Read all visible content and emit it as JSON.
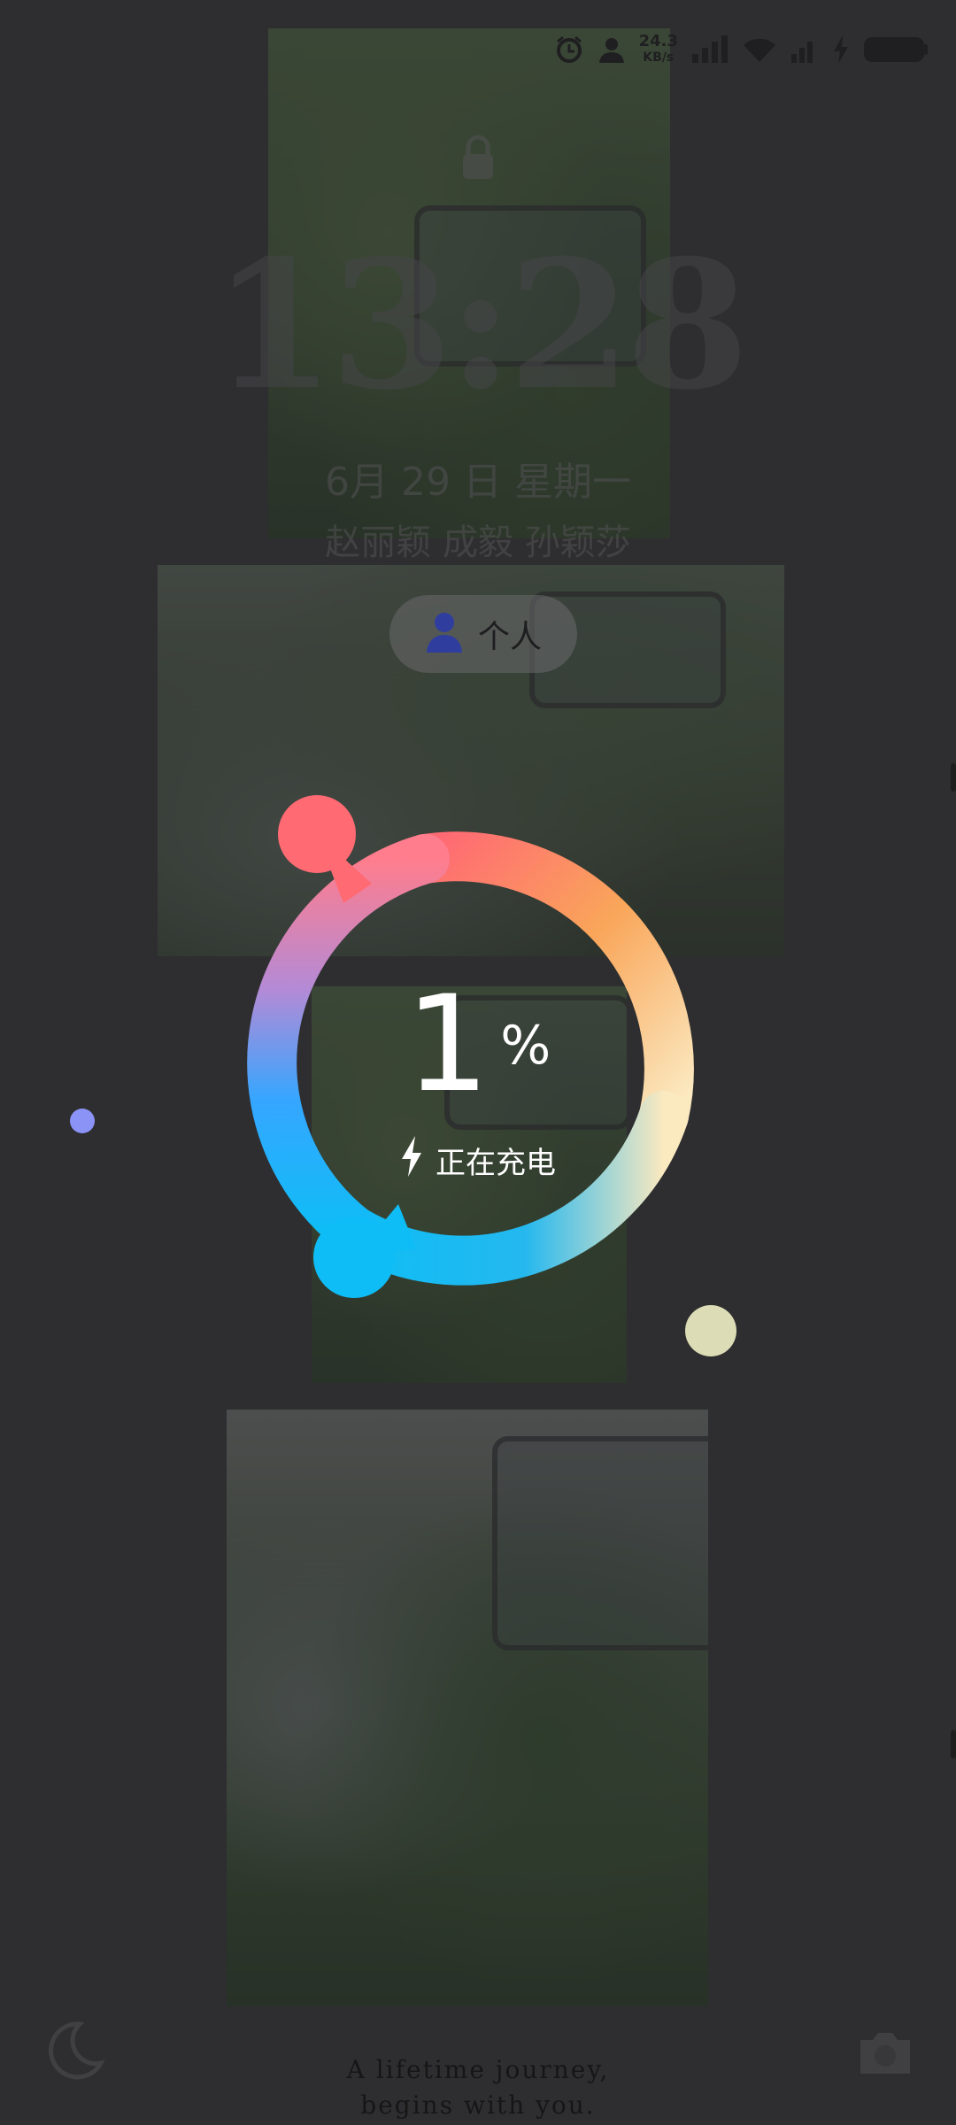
{
  "status_bar": {
    "net_speed_value": "24.3",
    "net_speed_unit": "KB/s",
    "icons": [
      "alarm-icon",
      "user-icon",
      "signal-icon",
      "wifi-icon",
      "battery-charging-icon"
    ]
  },
  "lockscreen": {
    "time": "13:28",
    "date": "6月 29 日 星期一",
    "names": "赵丽颖 成毅 孙颖莎",
    "profile_label": "个人"
  },
  "charging": {
    "percent_value": "1",
    "percent_sign": "%",
    "status_text": "正在充电",
    "level": 0.01
  },
  "footer": {
    "tagline_line1": "A lifetime journey,",
    "tagline_line2": "begins with you."
  },
  "colors": {
    "ring_red": "#ff6a73",
    "ring_orange": "#f9a65a",
    "ring_cream": "#fbe9c0",
    "ring_blue": "#35a6ff",
    "ring_cyan": "#0fbdf6",
    "dot_purple": "#8b93f7",
    "dot_cream": "#dcdcb6"
  }
}
